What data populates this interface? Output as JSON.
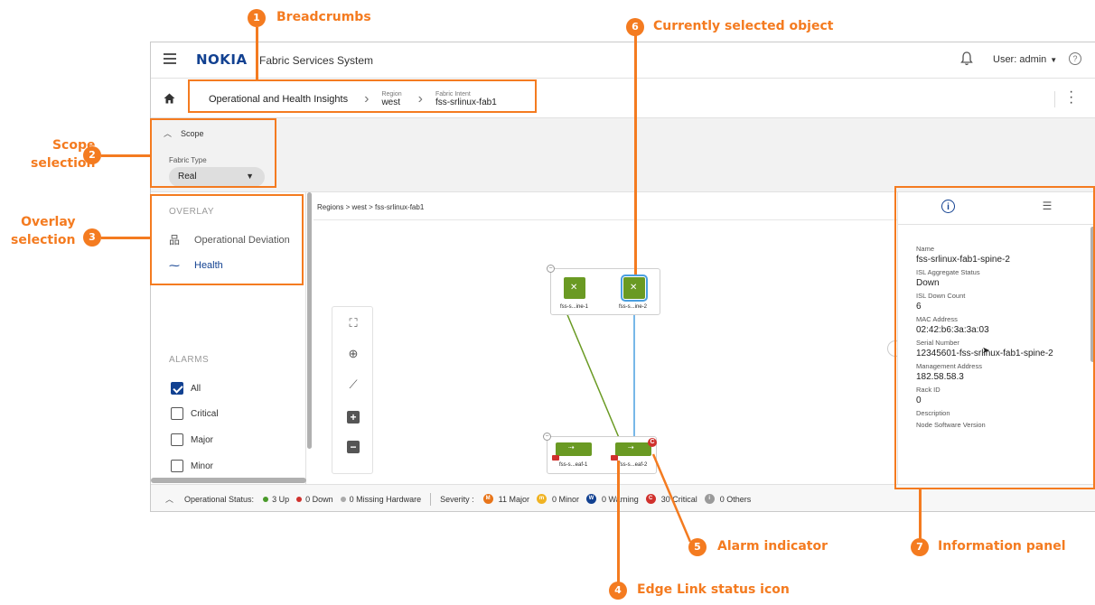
{
  "app": {
    "logo": "NOKIA",
    "title": "Fabric Services System",
    "user_label": "User: admin",
    "help": "?"
  },
  "breadcrumb": {
    "root": "Operational and Health Insights",
    "region_label": "Region",
    "region_value": "west",
    "intent_label": "Fabric Intent",
    "intent_value": "fss-srlinux-fab1"
  },
  "scope": {
    "header": "Scope",
    "fabric_type_label": "Fabric Type",
    "fabric_type_value": "Real"
  },
  "overlay": {
    "title": "OVERLAY",
    "items": [
      {
        "label": "Operational Deviation",
        "icon": "network-icon"
      },
      {
        "label": "Health",
        "icon": "pulse-icon"
      }
    ]
  },
  "alarms": {
    "title": "ALARMS",
    "items": [
      {
        "label": "All",
        "checked": true
      },
      {
        "label": "Critical",
        "checked": false
      },
      {
        "label": "Major",
        "checked": false
      },
      {
        "label": "Minor",
        "checked": false
      }
    ]
  },
  "canvas": {
    "breadcrumb": "Regions  >  west  >  fss-srlinux-fab1",
    "spine_nodes": [
      "fss-s...ine-1",
      "fss-s...ine-2"
    ],
    "leaf_nodes": [
      "fss-s...eaf-1",
      "fss-s...eaf-2"
    ],
    "alarm_badge": "C"
  },
  "info_panel": {
    "fields": [
      {
        "key": "Name",
        "value": "fss-srlinux-fab1-spine-2"
      },
      {
        "key": "ISL Aggregate Status",
        "value": "Down"
      },
      {
        "key": "ISL Down Count",
        "value": "6"
      },
      {
        "key": "MAC Address",
        "value": "02:42:b6:3a:3a:03"
      },
      {
        "key": "Serial Number",
        "value": "12345601-fss-srlinux-fab1-spine-2"
      },
      {
        "key": "Management Address",
        "value": "182.58.58.3"
      },
      {
        "key": "Rack ID",
        "value": "0"
      },
      {
        "key": "Description",
        "value": ""
      },
      {
        "key": "Node Software Version",
        "value": ""
      }
    ]
  },
  "status_bar": {
    "label": "Operational Status:",
    "up": "3 Up",
    "down": "0 Down",
    "missing": "0 Missing Hardware",
    "severity_label": "Severity :",
    "major": "11 Major",
    "minor": "0 Minor",
    "warning": "0 Warning",
    "critical": "30 Critical",
    "others": "0 Others"
  },
  "annotations": [
    {
      "number": "1",
      "text": "Breadcrumbs"
    },
    {
      "number": "2",
      "text": "Scope\nselection"
    },
    {
      "number": "3",
      "text": "Overlay\nselection"
    },
    {
      "number": "4",
      "text": "Edge Link status icon"
    },
    {
      "number": "5",
      "text": "Alarm indicator"
    },
    {
      "number": "6",
      "text": "Currently selected object"
    },
    {
      "number": "7",
      "text": "Information panel"
    }
  ],
  "colors": {
    "accent": "#124191",
    "node_green": "#6a9a23",
    "selected_link": "#4a9fe0",
    "annotation": "#f47b20",
    "critical": "#d0312d",
    "major": "#e8751a",
    "minor": "#f0b323",
    "warning": "#124191",
    "others": "#9a9a9a"
  }
}
